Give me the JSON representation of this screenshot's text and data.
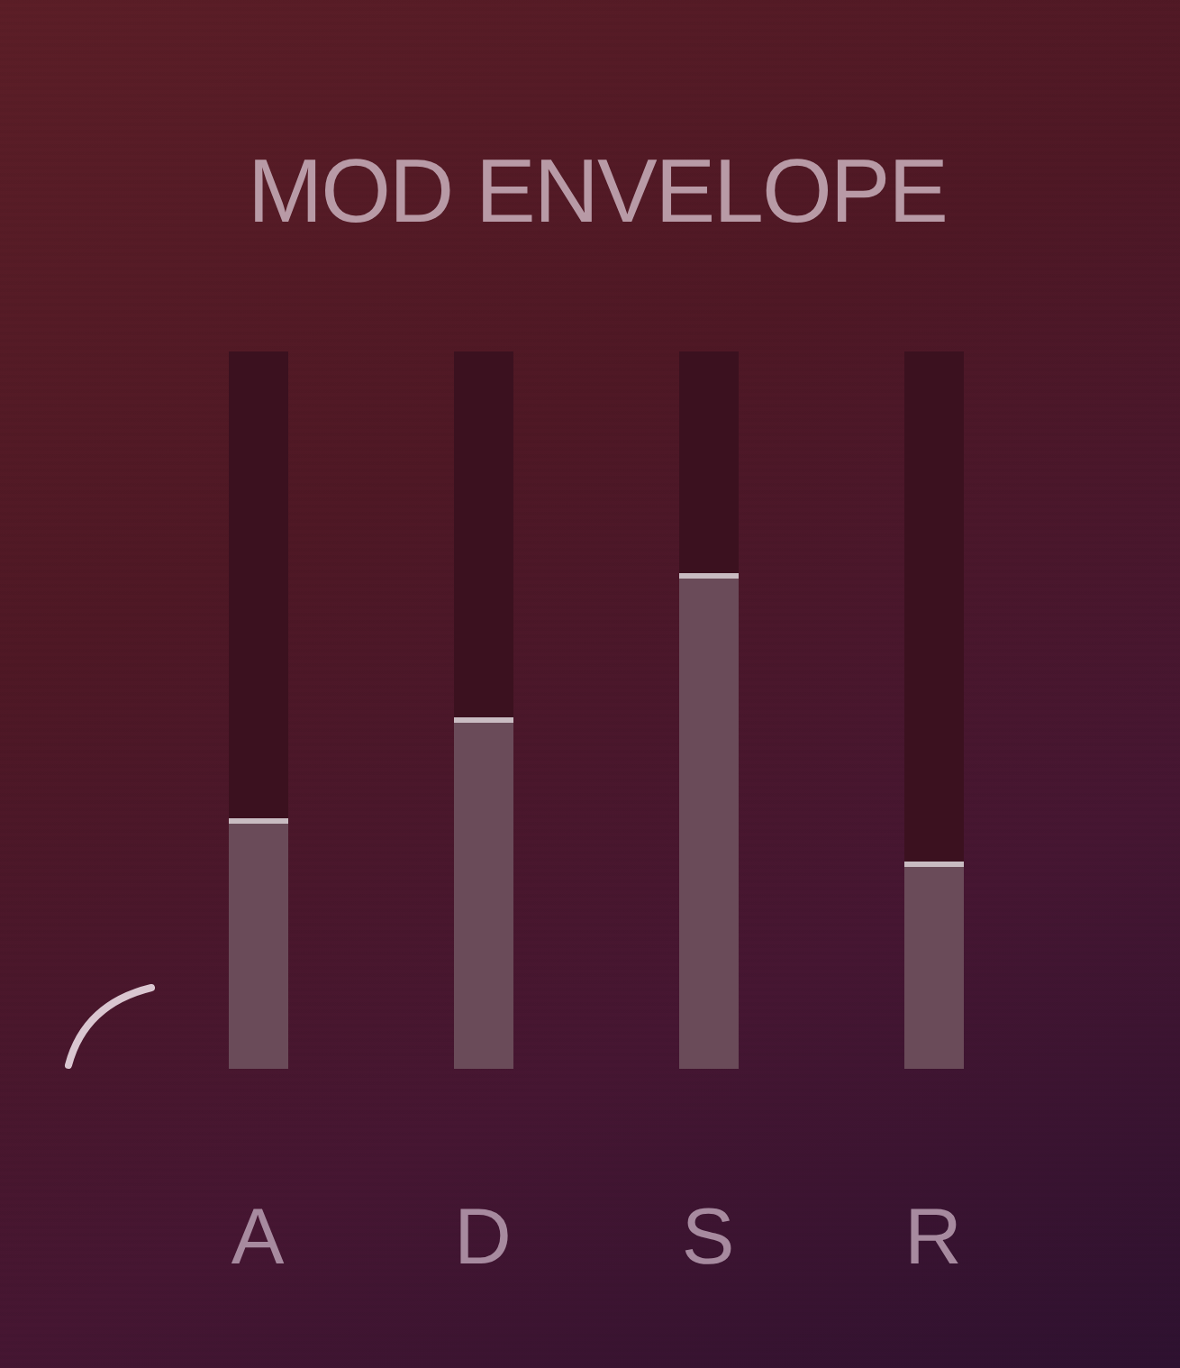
{
  "panel": {
    "title": "MOD ENVELOPE"
  },
  "sliders": [
    {
      "label": "A",
      "level": 0.35
    },
    {
      "label": "D",
      "level": 0.49
    },
    {
      "label": "S",
      "level": 0.69
    },
    {
      "label": "R",
      "level": 0.29
    }
  ]
}
